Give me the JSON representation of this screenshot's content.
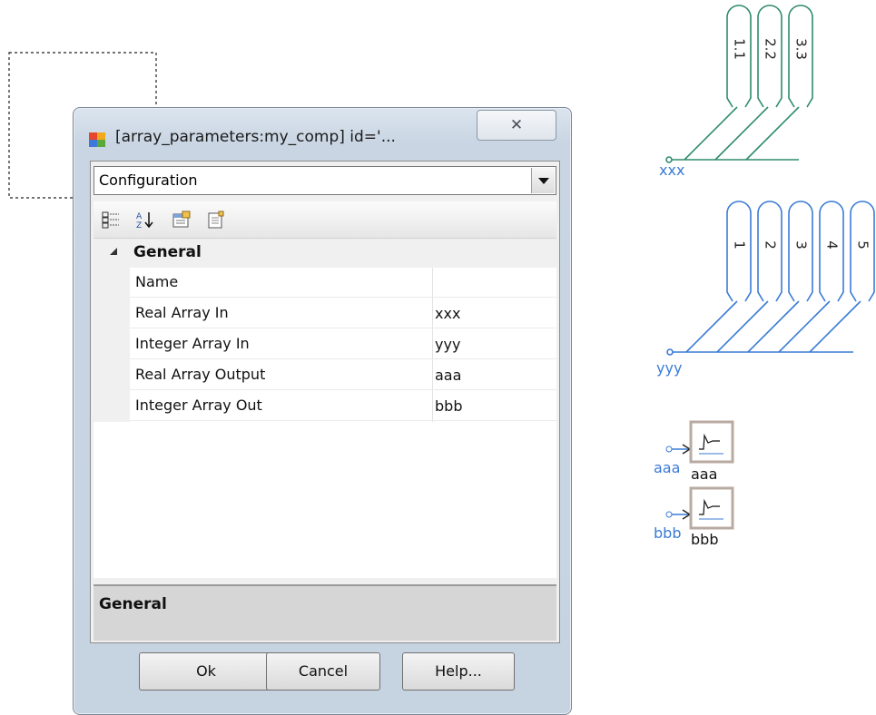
{
  "dialog": {
    "title": "[array_parameters:my_comp] id='...",
    "close_glyph": "☒",
    "category_select": "Configuration",
    "toolbar_icons": [
      "categorized-icon",
      "sort-alphabetical-icon",
      "property-pages-icon",
      "events-icon"
    ],
    "group_title": "General",
    "properties": [
      {
        "name": "Name",
        "value": ""
      },
      {
        "name": "Real Array In",
        "value": "xxx"
      },
      {
        "name": "Integer Array In",
        "value": "yyy"
      },
      {
        "name": "Real Array Output",
        "value": "aaa"
      },
      {
        "name": "Integer Array Out",
        "value": "bbb"
      }
    ],
    "description_title": "General",
    "buttons": {
      "ok": "Ok",
      "cancel": "Cancel",
      "help": "Help..."
    }
  },
  "diagram": {
    "green_array": {
      "label": "xxx",
      "elements": [
        "1.1",
        "2.2",
        "3.3"
      ],
      "color": "#2e8b6e"
    },
    "blue_array": {
      "label": "yyy",
      "elements": [
        "1",
        "2",
        "3",
        "4",
        "5"
      ],
      "color": "#3a7bd5"
    },
    "outputs": [
      {
        "wire_label": "aaa",
        "block_label": "aaa"
      },
      {
        "wire_label": "bbb",
        "block_label": "bbb"
      }
    ]
  }
}
